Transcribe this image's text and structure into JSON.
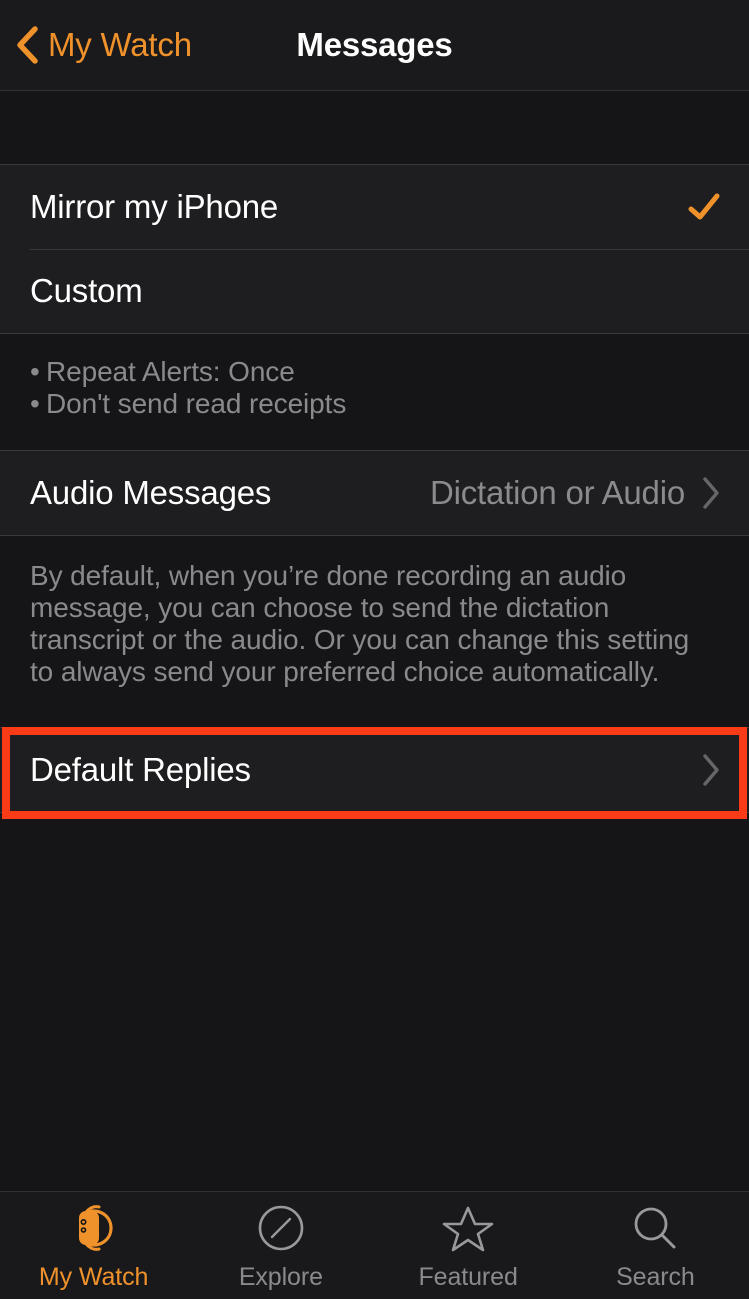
{
  "nav": {
    "back_label": "My Watch",
    "back_icon": "chevron-left-icon",
    "title": "Messages"
  },
  "colors": {
    "accent_orange": "#F0922B",
    "highlight_red": "#F93B18",
    "row_background": "#1E1E20",
    "page_background": "#151517",
    "primary_text": "#FFFFFF",
    "secondary_text": "#8A8A8E"
  },
  "alert_style_section": {
    "rows": [
      {
        "label": "Mirror my iPhone",
        "accessory": "checkmark-icon",
        "selected": true
      },
      {
        "label": "Custom",
        "accessory": "none",
        "selected": false
      }
    ]
  },
  "custom_summary": {
    "bullets": [
      "Repeat Alerts: Once",
      "Don't send read receipts"
    ],
    "bullet_char": "•"
  },
  "audio_section": {
    "row": {
      "label": "Audio Messages",
      "value": "Dictation or Audio",
      "accessory": "chevron-right-icon"
    }
  },
  "audio_footnote": "By default, when you’re done recording an audio message, you can choose to send the dictation transcript or the audio. Or you can change this setting to always send your preferred choice automatically.",
  "default_replies_section": {
    "row": {
      "label": "Default Replies",
      "accessory": "chevron-right-icon"
    },
    "highlighted": true
  },
  "tabbar": {
    "tabs": [
      {
        "label": "My Watch",
        "icon": "watch-icon",
        "active": true
      },
      {
        "label": "Explore",
        "icon": "compass-icon",
        "active": false
      },
      {
        "label": "Featured",
        "icon": "star-icon",
        "active": false
      },
      {
        "label": "Search",
        "icon": "magnifier-icon",
        "active": false
      }
    ]
  }
}
